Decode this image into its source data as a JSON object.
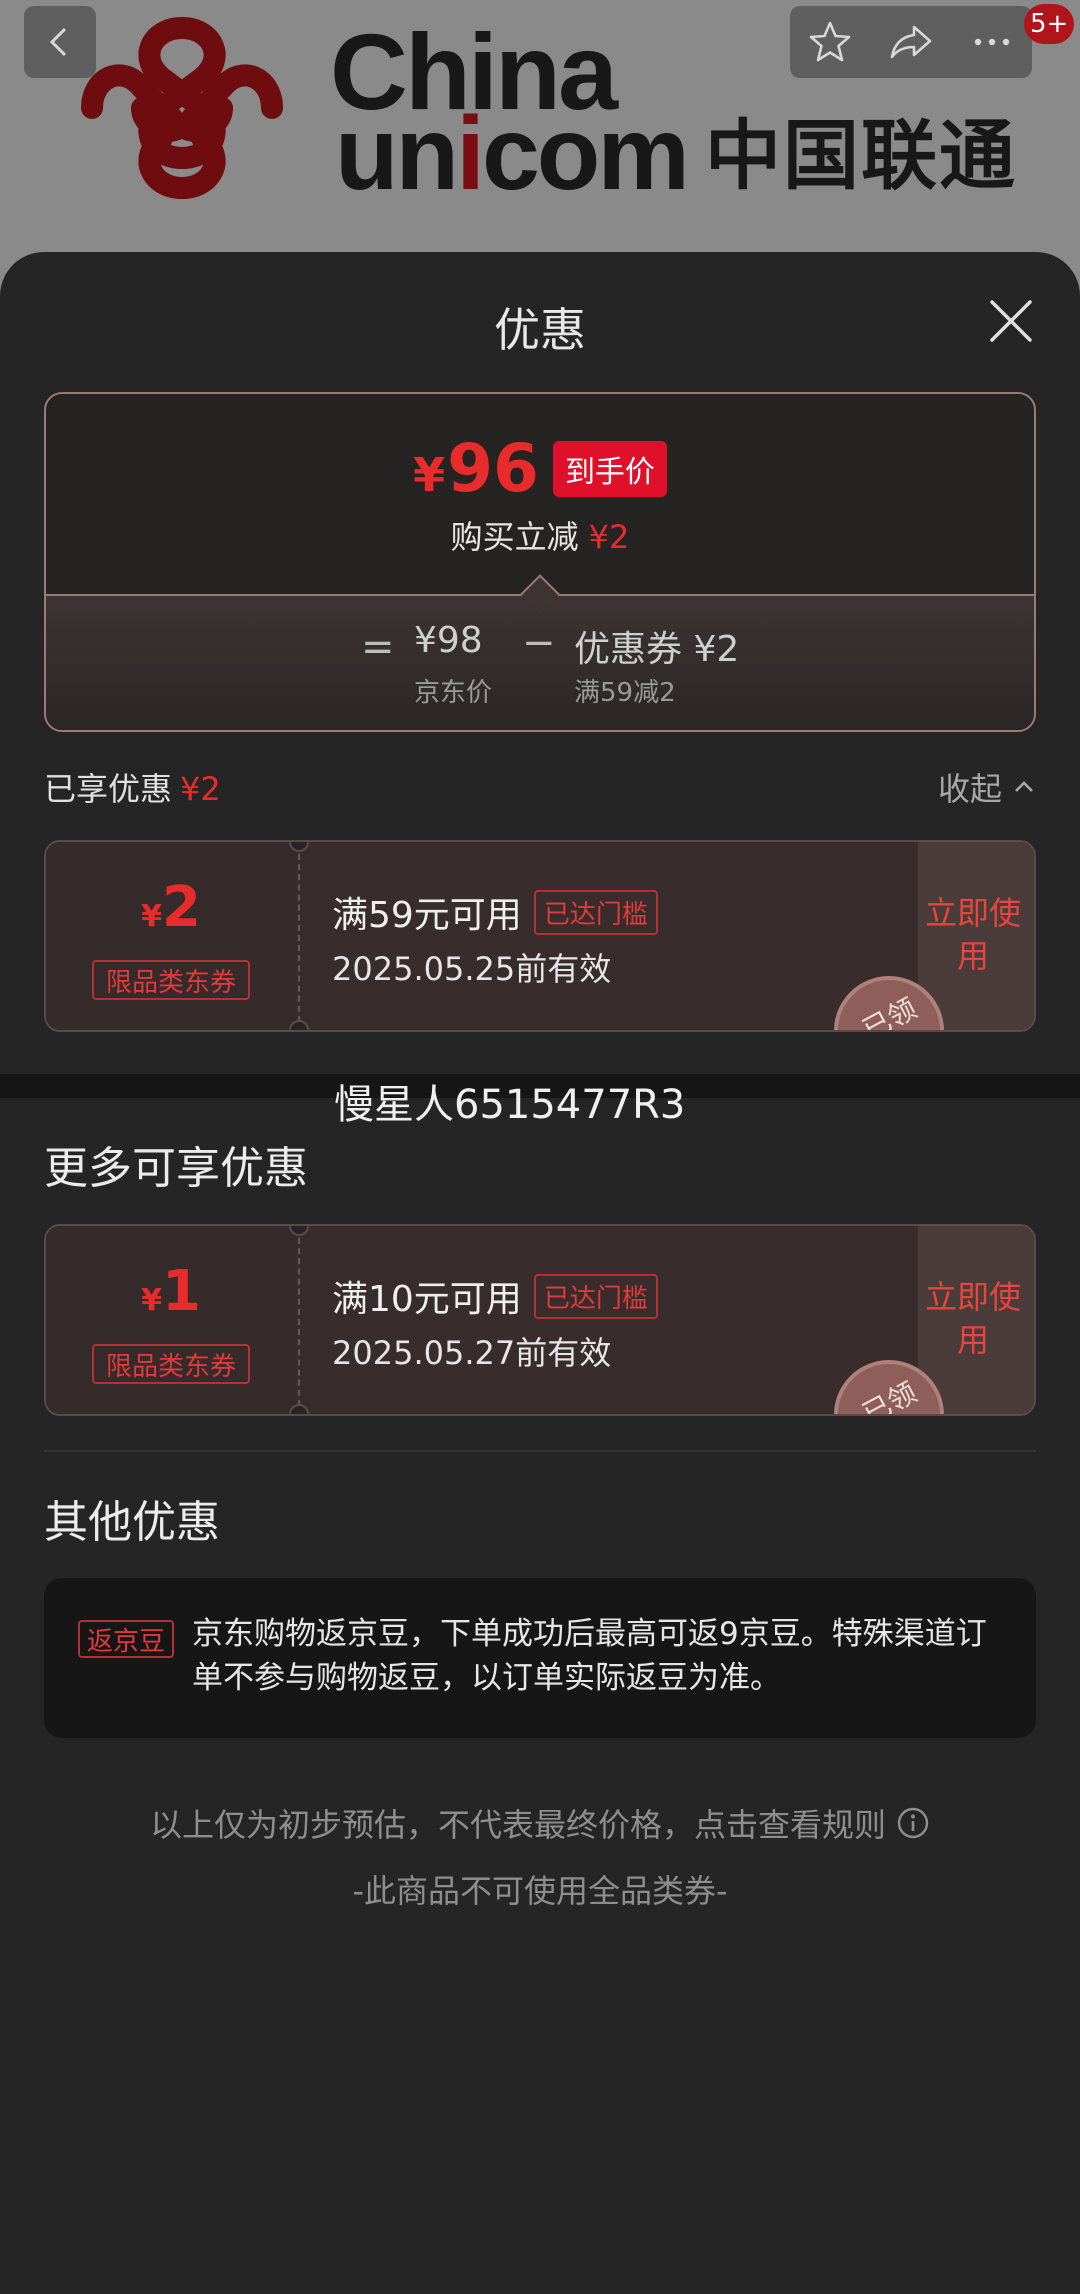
{
  "banner": {
    "logo_china": "China",
    "logo_unicom_a": "un",
    "logo_unicom_i": "i",
    "logo_unicom_b": "com",
    "logo_cn": "中国联通",
    "badge": "5+"
  },
  "sheet": {
    "title": "优惠"
  },
  "summary": {
    "final_yen": "¥",
    "final_price": "96",
    "final_tag": "到手价",
    "reduce_label": "购买立减",
    "reduce_amount": "¥2",
    "eq": "=",
    "jd_price": "¥98",
    "jd_price_label": "京东价",
    "minus": "−",
    "coupon": "优惠券 ¥2",
    "coupon_rule": "满59减2"
  },
  "enjoyed": {
    "label": "已享优惠",
    "amount": "¥2",
    "collapse": "收起"
  },
  "coupons": [
    {
      "yen": "¥",
      "amount": "2",
      "category": "限品类东券",
      "condition": "满59元可用",
      "reached": "已达门槛",
      "valid": "2025.05.25前有效",
      "use": "立即使用",
      "stamp": "已领"
    },
    {
      "yen": "¥",
      "amount": "1",
      "category": "限品类东券",
      "condition": "满10元可用",
      "reached": "已达门槛",
      "valid": "2025.05.27前有效",
      "use": "立即使用",
      "stamp": "已领"
    }
  ],
  "watermark": "慢星人6515477R3",
  "more_title": "更多可享优惠",
  "other_title": "其他优惠",
  "other": {
    "tag": "返京豆",
    "text": "京东购物返京豆，下单成功后最高可返9京豆。特殊渠道订单不参与购物返豆，以订单实际返豆为准。"
  },
  "footer": {
    "note": "以上仅为初步预估，不代表最终价格，点击查看规则",
    "note2": "-此商品不可使用全品类券-"
  },
  "colors": {
    "accent_red": "#e82b2b",
    "sheet_bg": "#252526"
  }
}
